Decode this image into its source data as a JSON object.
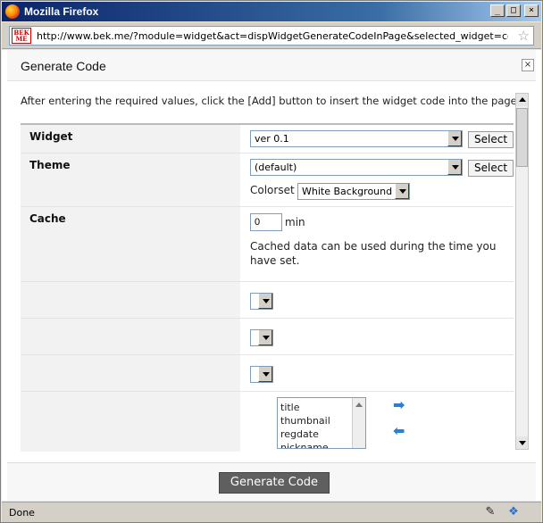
{
  "window": {
    "title": "Mozilla Firefox",
    "minimize": "_",
    "maximize": "□",
    "close": "×"
  },
  "address_bar": {
    "favicon_text": "BEK ME",
    "url": "http://www.bek.me/?module=widget&act=dispWidgetGenerateCodeInPage&selected_widget=content&widge",
    "bookmark_icon": "star-icon"
  },
  "dialog": {
    "title": "Generate Code",
    "close_label": "×",
    "intro": "After entering the required values, click the [Add] button to insert the widget code into the page.",
    "rows": {
      "widget": {
        "label": "Widget",
        "select_value": "ver 0.1",
        "button": "Select"
      },
      "theme": {
        "label": "Theme",
        "select_value": "(default)",
        "button": "Select",
        "colorset_label": "Colorset",
        "colorset_value": "White Background"
      },
      "cache": {
        "label": "Cache",
        "value": "0",
        "unit": "min",
        "help": "Cached data can be used during the time you have set."
      },
      "fields": {
        "list_items": [
          "title",
          "thumbnail",
          "regdate",
          "nickname"
        ]
      }
    },
    "generate_button": "Generate Code"
  },
  "status_bar": {
    "text": "Done"
  },
  "colors": {
    "titlebar": "#0a246a",
    "button_dark": "#5f5f5f",
    "arrow_blue": "#2a7fd4"
  }
}
